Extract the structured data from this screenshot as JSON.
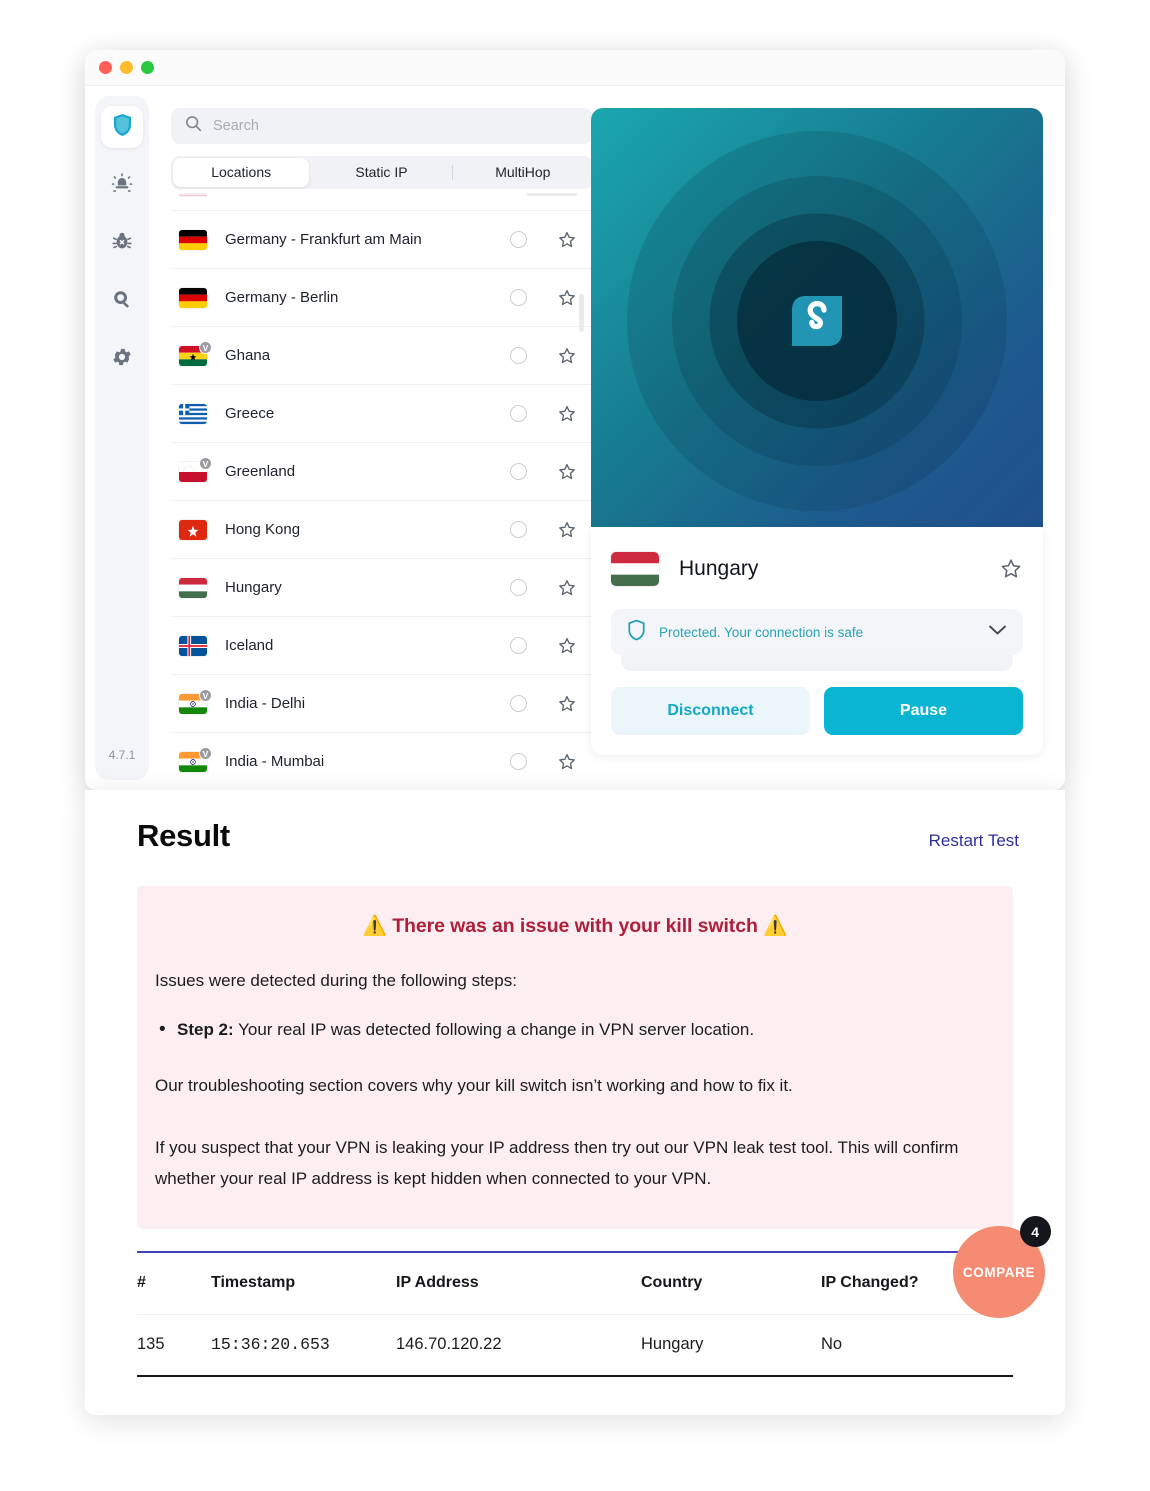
{
  "vpn_app": {
    "version": "4.7.1",
    "rail": [
      {
        "name": "vpn-shield",
        "icon": "shield-icon",
        "active": true
      },
      {
        "name": "alert",
        "icon": "alert-siren-icon",
        "active": false
      },
      {
        "name": "antivirus",
        "icon": "bug-icon",
        "active": false
      },
      {
        "name": "search-alert",
        "icon": "magnifier-icon",
        "active": false
      },
      {
        "name": "settings",
        "icon": "gear-icon",
        "active": false
      }
    ],
    "search": {
      "placeholder": "Search",
      "value": ""
    },
    "tabs": [
      {
        "label": "Locations",
        "active": true
      },
      {
        "label": "Static IP",
        "active": false
      },
      {
        "label": "MultiHop",
        "active": false
      }
    ],
    "locations": [
      {
        "name": "Germany - Frankfurt am Main",
        "flag": "de",
        "virtual": false
      },
      {
        "name": "Germany - Berlin",
        "flag": "de",
        "virtual": false
      },
      {
        "name": "Ghana",
        "flag": "gh",
        "virtual": true
      },
      {
        "name": "Greece",
        "flag": "gr",
        "virtual": false
      },
      {
        "name": "Greenland",
        "flag": "gl",
        "virtual": true
      },
      {
        "name": "Hong Kong",
        "flag": "hk",
        "virtual": false
      },
      {
        "name": "Hungary",
        "flag": "hu",
        "virtual": false
      },
      {
        "name": "Iceland",
        "flag": "is",
        "virtual": false
      },
      {
        "name": "India - Delhi",
        "flag": "in",
        "virtual": true
      },
      {
        "name": "India - Mumbai",
        "flag": "in",
        "virtual": true
      }
    ],
    "connection": {
      "country": "Hungary",
      "status_text": "Protected. Your connection is safe",
      "disconnect_label": "Disconnect",
      "pause_label": "Pause"
    }
  },
  "result": {
    "title": "Result",
    "restart_label": "Restart Test",
    "alert": {
      "title": "⚠️ There was an issue with your kill switch ⚠️",
      "intro": "Issues were detected during the following steps:",
      "step_label": "Step 2:",
      "step_text": " Your real IP was detected following a change in VPN server location.",
      "para1": "Our troubleshooting section covers why your kill switch isn’t working and how to fix it.",
      "para2": "If you suspect that your VPN is leaking your IP address then try out our VPN leak test tool. This will confirm whether your real IP address is kept hidden when connected to your VPN."
    },
    "table": {
      "columns": [
        "#",
        "Timestamp",
        "IP Address",
        "Country",
        "IP Changed?"
      ],
      "rows": [
        {
          "num": "135",
          "timestamp": "15:36:20.653",
          "ip": "146.70.120.22",
          "country": "Hungary",
          "changed": "No"
        }
      ]
    }
  },
  "compare_fab": {
    "label": "COMPARE",
    "count": "4"
  },
  "colors": {
    "accent_cyan": "#0AB5D4",
    "alert_red": "#AF1F3C",
    "alert_bg": "#FDEFF1",
    "link_indigo": "#2F2FA0",
    "fab_salmon": "#F48B72"
  }
}
